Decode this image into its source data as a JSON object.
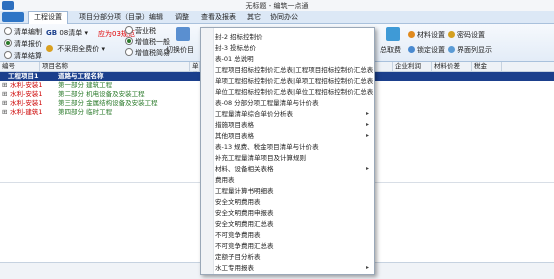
{
  "window": {
    "title": "无标题 - 编筑一点通"
  },
  "menu": [
    {
      "label": "工程设置",
      "active": true
    },
    {
      "label": "项目分部分项（目录）"
    },
    {
      "label": "编辑"
    },
    {
      "label": "调整"
    },
    {
      "label": "查看及报表"
    },
    {
      "label": "其它"
    },
    {
      "label": "协同办公"
    }
  ],
  "ribbon": {
    "bill_edit": "清单编制",
    "bill_quote": "清单报价",
    "bill_settle": "清单结算",
    "gb_label": "GB",
    "gb_standard": "08清单",
    "no_default_price": "不采用全费价",
    "business_tax": "营业税",
    "vat_general": "增值税一般",
    "vat_simple": "增值税简易",
    "switch_quota": "切换价目",
    "note": "应为03规范",
    "summary": "总取费",
    "material_settings": "材料设置",
    "password_settings": "密码设置",
    "lock_settings": "锁定设置",
    "interface_display": "界面列显示"
  },
  "columns": [
    "编号",
    "项目名称",
    "单位",
    "企业利润",
    "材料价差",
    "税金"
  ],
  "project": {
    "code": "工程项目1",
    "name": "道路与工程名称"
  },
  "rows": [
    {
      "code": "水利-安装1",
      "name": "第一部分  建筑工程"
    },
    {
      "code": "水利-安装1",
      "name": "第二部分  机电设备及安装工程"
    },
    {
      "code": "水利-安装1",
      "name": "第三部分  金属结构设备及安装工程"
    },
    {
      "code": "水利-建筑1",
      "name": "第四部分  临时工程"
    }
  ],
  "dropdown": {
    "items": [
      {
        "label": "封-2 招标控制价",
        "sub": false
      },
      {
        "label": "封-3 投标总价",
        "sub": false
      },
      {
        "label": "表-01 总说明",
        "sub": false
      },
      {
        "label": "工程项目招标控制价汇总表|工程项目招标控制价汇总表",
        "sub": false
      },
      {
        "label": "单项工程招标控制价汇总表|单项工程招标控制价汇总表",
        "sub": false
      },
      {
        "label": "单位工程招标控制价汇总表|单位工程招标控制价汇总表",
        "sub": false
      },
      {
        "label": "表-08 分部分项工程量清单与计价表",
        "sub": false
      },
      {
        "label": "工程量清单综合单价分析表",
        "sub": true
      },
      {
        "label": "措施项目表格",
        "sub": true
      },
      {
        "label": "其他项目表格",
        "sub": true
      },
      {
        "label": "表-13 规费、税金项目清单与计价表",
        "sub": false
      },
      {
        "label": "补充工程量清单项目及计算规则",
        "sub": false
      },
      {
        "label": "材料、设备相关表格",
        "sub": true
      },
      {
        "label": "费用表",
        "sub": false
      },
      {
        "label": "工程量计算书明细表",
        "sub": false
      },
      {
        "label": "安全文明费用表",
        "sub": false
      },
      {
        "label": "安全文明费用申报表",
        "sub": false
      },
      {
        "label": "安全文明费用汇总表",
        "sub": false
      },
      {
        "label": "不可竞争费用表",
        "sub": false
      },
      {
        "label": "不可竞争费用汇总表",
        "sub": false
      },
      {
        "label": "定额子目分析表",
        "sub": false
      },
      {
        "label": "水工专用报表",
        "sub": true
      }
    ]
  },
  "colors": {
    "note": "#e00000",
    "project_row": "#1b3f8c",
    "code_text": "#cc0000",
    "name_text": "#2a7a2a",
    "menu_bar": "#dce8f6"
  }
}
